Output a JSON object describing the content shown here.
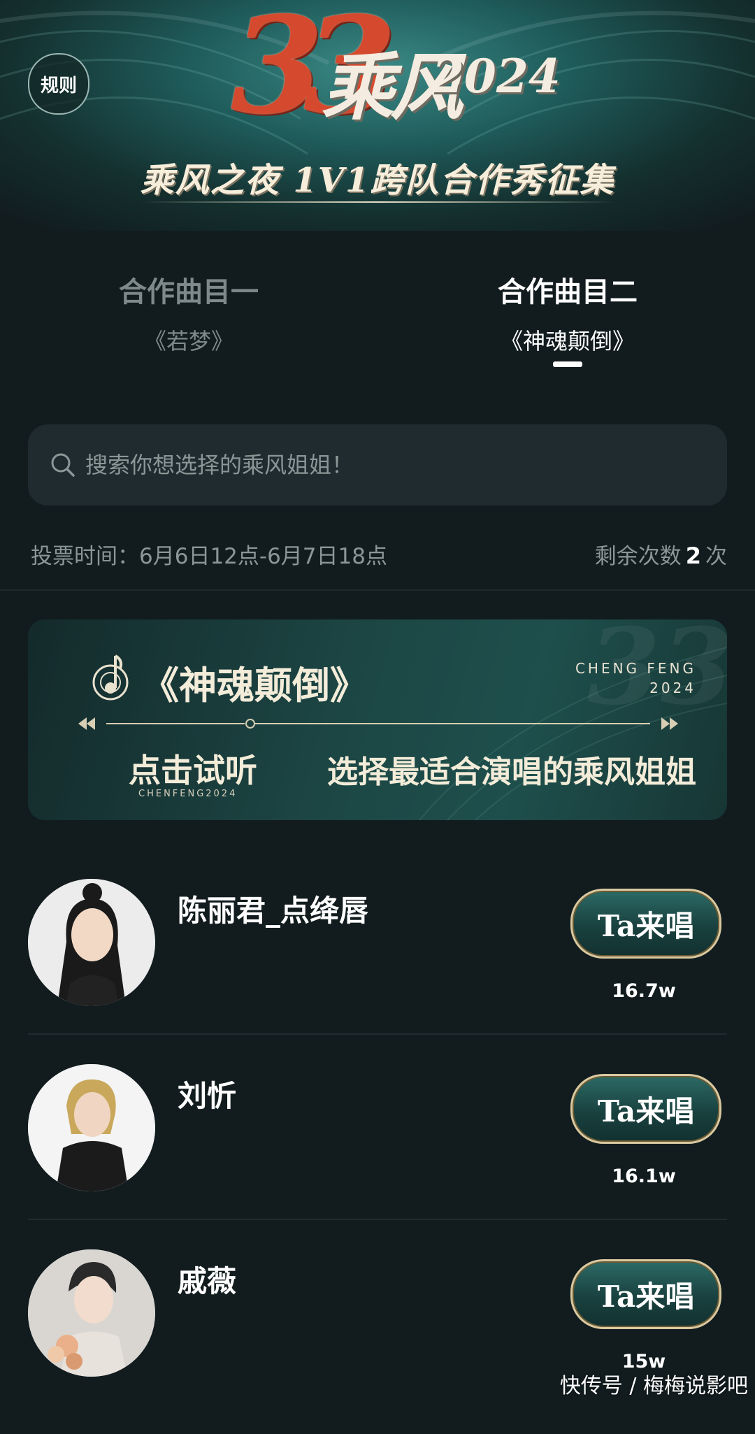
{
  "header": {
    "rules_label": "规则",
    "logo_number": "33",
    "logo_text": "乘风",
    "logo_year": "2024",
    "title": "乘风之夜 1V1跨队合作秀征集"
  },
  "tabs": [
    {
      "title": "合作曲目一",
      "song": "《若梦》",
      "active": false
    },
    {
      "title": "合作曲目二",
      "song": "《神魂颠倒》",
      "active": true
    }
  ],
  "search": {
    "placeholder": "搜索你想选择的乘风姐姐！"
  },
  "vote_info": {
    "time": "投票时间：6月6日12点-6月7日18点",
    "remaining_label": "剩余次数",
    "remaining_count": "2",
    "remaining_unit": "次"
  },
  "banner": {
    "song": "《神魂颠倒》",
    "brand_line1": "CHENG FENG",
    "brand_line2": "2024",
    "listen_label": "点击试听",
    "listen_sub": "CHENFENG2024",
    "tagline": "选择最适合演唱的乘风姐姐"
  },
  "contestants": [
    {
      "name": "陈丽君_点绛唇",
      "button": "Ta来唱",
      "votes": "16.7w"
    },
    {
      "name": "刘忻",
      "button": "Ta来唱",
      "votes": "16.1w"
    },
    {
      "name": "戚薇",
      "button": "Ta来唱",
      "votes": "15w"
    }
  ],
  "watermark": "快传号 / 梅梅说影吧"
}
